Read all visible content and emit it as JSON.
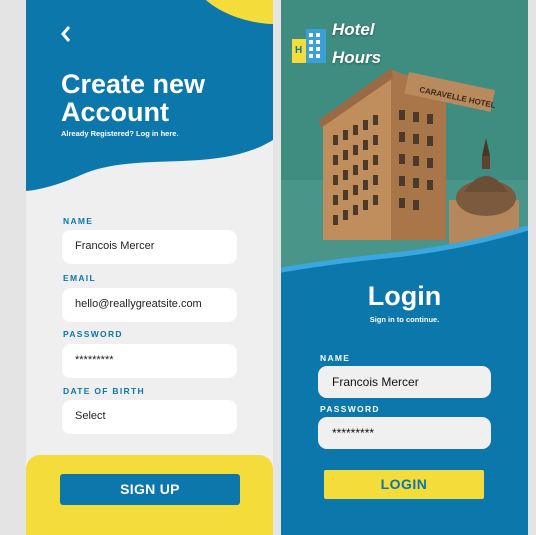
{
  "signup": {
    "back_icon": "chevron-left-icon",
    "title_line1": "Create new",
    "title_line2": "Account",
    "subtitle": "Already Registered? Log in here.",
    "fields": [
      {
        "label": "NAME",
        "value": "Francois Mercer"
      },
      {
        "label": "EMAIL",
        "value": "hello@reallygreatsite.com"
      },
      {
        "label": "PASSWORD",
        "value": "*********"
      },
      {
        "label": "DATE OF BIRTH",
        "value": "Select"
      }
    ],
    "button_label": "SIGN UP"
  },
  "login": {
    "brand_icon": "hotel-building-icon",
    "brand_line1": "Hotel",
    "brand_line2": "Hours",
    "hotel_sign": "CARAVELLE HOTEL",
    "title": "Login",
    "subtitle": "Sign in to continue.",
    "fields": [
      {
        "label": "NAME",
        "value": "Francois Mercer"
      },
      {
        "label": "PASSWORD",
        "value": "*********"
      }
    ],
    "button_label": "LOGIN"
  },
  "colors": {
    "primary_blue": "#0b77ab",
    "accent_yellow": "#f4dd3a",
    "background": "#efefef"
  }
}
